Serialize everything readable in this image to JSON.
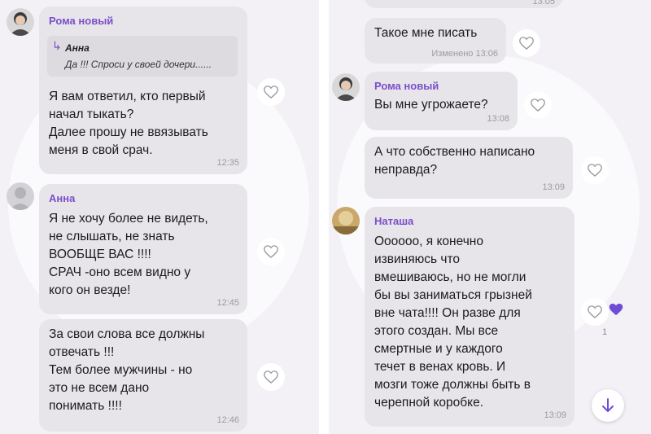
{
  "left_chat": {
    "msg1": {
      "sender": "Рома новый",
      "reply_to": {
        "name": "Анна",
        "text": "Да !!! Спроси у своей дочери......"
      },
      "text": "Я вам ответил, кто первый\nначал тыкать?\nДалее прошу не ввязывать\nменя в свой срач.",
      "time": "12:35"
    },
    "msg2": {
      "sender": "Анна",
      "text": "Я не хочу более не видеть,\nне слышать, не знать\nВООБЩЕ ВАС !!!!\nСРАЧ -оно всем видно у\nкого он везде!",
      "time": "12:45"
    },
    "msg3": {
      "text": "За свои слова все должны\nотвечать !!!\nТем более мужчины - но\nэто не всем дано\nпонимать !!!!",
      "time": "12:46"
    }
  },
  "right_chat": {
    "msg0": {
      "time": "13:05"
    },
    "msg1": {
      "text": "Такое мне писать",
      "time": "Изменено 13:06"
    },
    "msg2": {
      "sender": "Рома новый",
      "text": "Вы мне угрожаете?",
      "time": "13:08"
    },
    "msg3": {
      "text": "А что собственно написано\nнеправда?",
      "time": "13:09"
    },
    "msg4": {
      "sender": "Наташа",
      "text": "Оооооо, я конечно\nизвиняюсь что\nвмешиваюсь, но не могли\nбы вы заниматься грызней\nвне чата!!!! Он разве для\nэтого создан. Мы все\nсмертные и у каждого\nтечет в венах кровь. И\nмозги тоже должны быть в\nчерепной коробке.",
      "time": "13:09",
      "reaction_count": "1"
    }
  },
  "icons": {
    "like": "heart-outline-icon",
    "liked": "heart-filled-icon",
    "scroll_down": "arrow-down-icon",
    "reply": "reply-arrow-icon"
  },
  "colors": {
    "accent": "#7a4fc9",
    "bubble": "#e7e5ea",
    "background": "#f3f1f6",
    "time": "#9a9aa0"
  }
}
